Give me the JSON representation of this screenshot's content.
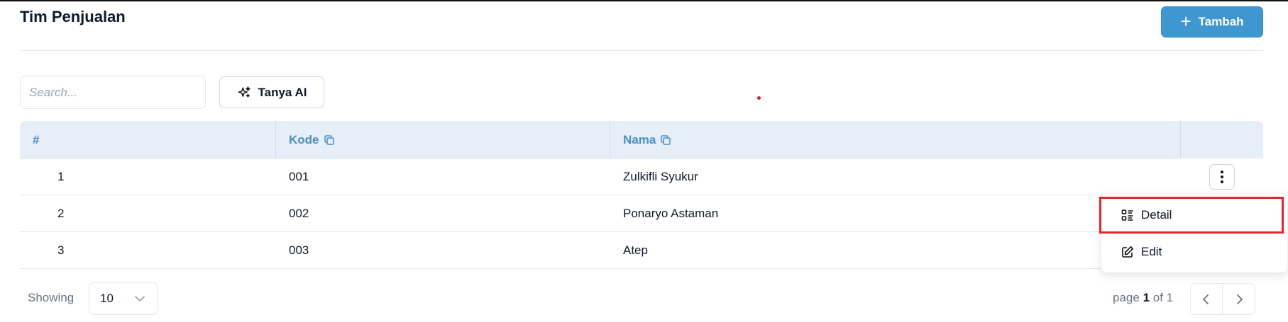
{
  "header": {
    "title": "Tim Penjualan",
    "add_label": "Tambah"
  },
  "toolbar": {
    "search_placeholder": "Search...",
    "ai_label": "Tanya AI"
  },
  "table": {
    "columns": [
      "#",
      "Kode",
      "Nama"
    ],
    "rows": [
      {
        "num": "1",
        "kode": "001",
        "nama": "Zulkifli Syukur"
      },
      {
        "num": "2",
        "kode": "002",
        "nama": "Ponaryo Astaman"
      },
      {
        "num": "3",
        "kode": "003",
        "nama": "Atep"
      }
    ]
  },
  "row_menu": {
    "items": [
      "Detail",
      "Edit"
    ]
  },
  "footer": {
    "showing_label": "Showing",
    "page_size": "10",
    "page_prefix": "page",
    "page_current": "1",
    "page_of": "of 1"
  },
  "colors": {
    "accent": "#3f97d1",
    "header_bg": "#e6eef8",
    "header_text": "#4a8ec6",
    "highlight": "#e3262a"
  }
}
